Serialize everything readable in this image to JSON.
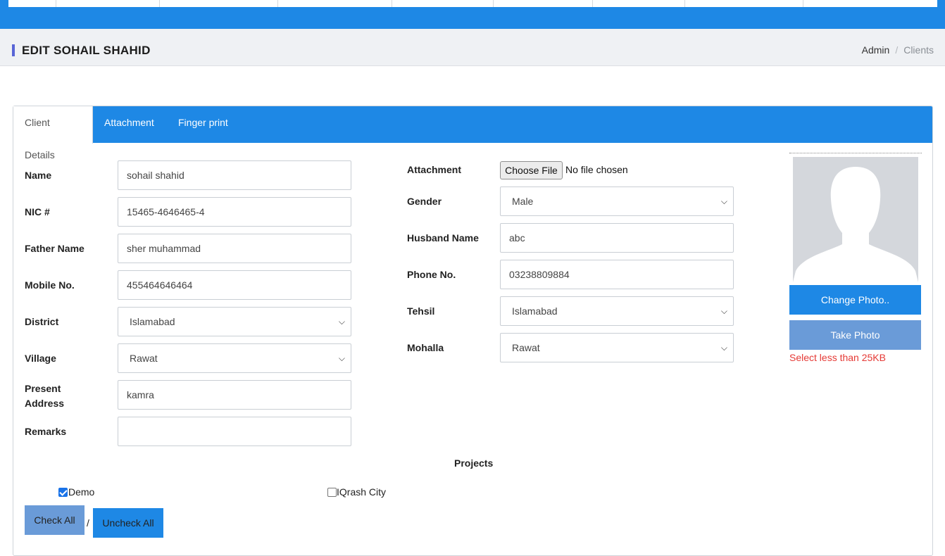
{
  "header": {
    "page_title": "EDIT SOHAIL SHAHID",
    "breadcrumb": {
      "parent": "Admin",
      "separator": "/",
      "current": "Clients"
    }
  },
  "tabs": [
    {
      "label": "Client Details",
      "active": true
    },
    {
      "label": "Attachment",
      "active": false
    },
    {
      "label": "Finger print",
      "active": false
    }
  ],
  "form_left": {
    "name": {
      "label": "Name",
      "value": "sohail shahid"
    },
    "nic": {
      "label": "NIC #",
      "value": "15465-4646465-4"
    },
    "father_name": {
      "label": "Father Name",
      "value": "sher muhammad"
    },
    "mobile": {
      "label": "Mobile No.",
      "value": "455464646464"
    },
    "district": {
      "label": "District",
      "value": "Islamabad"
    },
    "village": {
      "label": "Village",
      "value": "Rawat"
    },
    "present_address": {
      "label": "Present Address",
      "value": "kamra"
    },
    "remarks": {
      "label": "Remarks",
      "value": ""
    }
  },
  "form_right": {
    "attachment": {
      "label": "Attachment",
      "button": "Choose File",
      "status": "No file chosen"
    },
    "gender": {
      "label": "Gender",
      "value": "Male"
    },
    "husband_name": {
      "label": "Husband Name",
      "value": "abc"
    },
    "phone": {
      "label": "Phone No.",
      "value": "03238809884"
    },
    "tehsil": {
      "label": "Tehsil",
      "value": "Islamabad"
    },
    "mohalla": {
      "label": "Mohalla",
      "value": "Rawat"
    }
  },
  "photo_panel": {
    "change_photo": "Change Photo..",
    "take_photo": "Take Photo",
    "warning": "Select less than 25KB"
  },
  "projects": {
    "title": "Projects",
    "items": [
      {
        "label": "Demo",
        "checked": true
      },
      {
        "label": "IQrash City",
        "checked": false
      }
    ],
    "check_all": "Check All",
    "separator": "/",
    "uncheck_all": "Uncheck All"
  },
  "colors": {
    "primary": "#1e88e5",
    "light_button": "#6a9bd8",
    "warning": "#e53935",
    "title_accent": "#5865d6"
  }
}
